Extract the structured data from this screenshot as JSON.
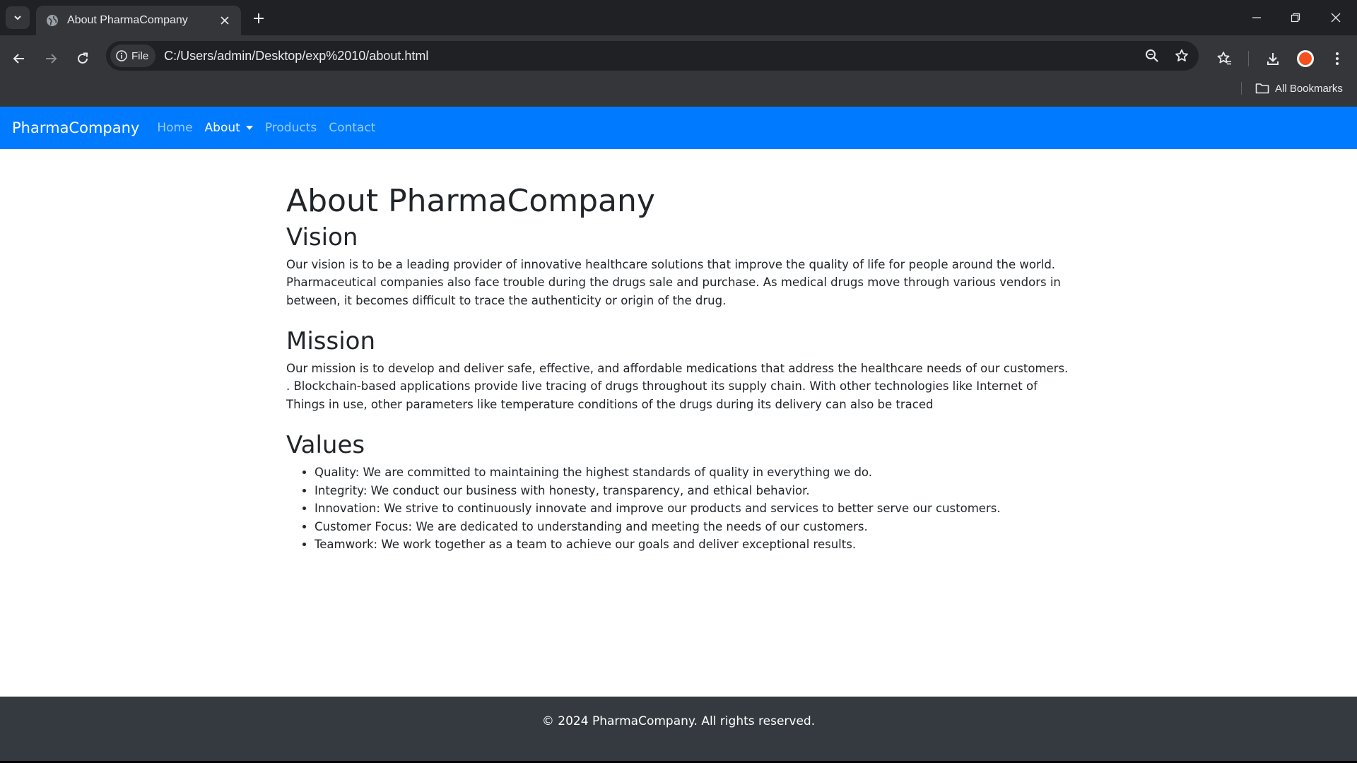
{
  "browser": {
    "tab_title": "About PharmaCompany",
    "site_chip_label": "File",
    "url": "C:/Users/admin/Desktop/exp%2010/about.html",
    "all_bookmarks_label": "All Bookmarks",
    "avatar_color": "#f4511e"
  },
  "navbar": {
    "brand": "PharmaCompany",
    "links": [
      {
        "label": "Home"
      },
      {
        "label": "About"
      },
      {
        "label": "Products"
      },
      {
        "label": "Contact"
      }
    ],
    "active": "About",
    "color": "#007bff"
  },
  "main": {
    "title": "About PharmaCompany",
    "vision": {
      "heading": "Vision",
      "text": "Our vision is to be a leading provider of innovative healthcare solutions that improve the quality of life for people around the world. Pharmaceutical companies also face trouble during the drugs sale and purchase. As medical drugs move through various vendors in between, it becomes difficult to trace the authenticity or origin of the drug."
    },
    "mission": {
      "heading": "Mission",
      "text": "Our mission is to develop and deliver safe, effective, and affordable medications that address the healthcare needs of our customers. . Blockchain-based applications provide live tracing of drugs throughout its supply chain. With other technologies like Internet of Things in use, other parameters like temperature conditions of the drugs during its delivery can also be traced"
    },
    "values": {
      "heading": "Values",
      "items": [
        "Quality: We are committed to maintaining the highest standards of quality in everything we do.",
        "Integrity: We conduct our business with honesty, transparency, and ethical behavior.",
        "Innovation: We strive to continuously innovate and improve our products and services to better serve our customers.",
        "Customer Focus: We are dedicated to understanding and meeting the needs of our customers.",
        "Teamwork: We work together as a team to achieve our goals and deliver exceptional results."
      ]
    }
  },
  "footer": {
    "text": "© 2024 PharmaCompany. All rights reserved.",
    "color": "#343a40"
  }
}
